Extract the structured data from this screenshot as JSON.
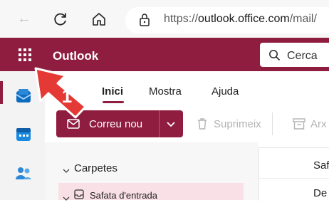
{
  "browser": {
    "url_prefix": "https://",
    "url_host": "outlook.office.com",
    "url_path": "/mail/"
  },
  "app": {
    "title": "Outlook"
  },
  "search": {
    "placeholder": "Cerca"
  },
  "ribbon_tabs": [
    "Inici",
    "Mostra",
    "Ajuda"
  ],
  "commands": {
    "new_mail": "Correu nou",
    "delete": "Suprimeix",
    "archive": "Arx"
  },
  "folders": {
    "header": "Carpetes",
    "inbox": "Safata d'entrada"
  },
  "message_list": {
    "header": "Saf",
    "row1": "De"
  },
  "annotation": {
    "step": "1"
  },
  "colors": {
    "brand": "#8f1d3f",
    "callout": "#e53935"
  }
}
